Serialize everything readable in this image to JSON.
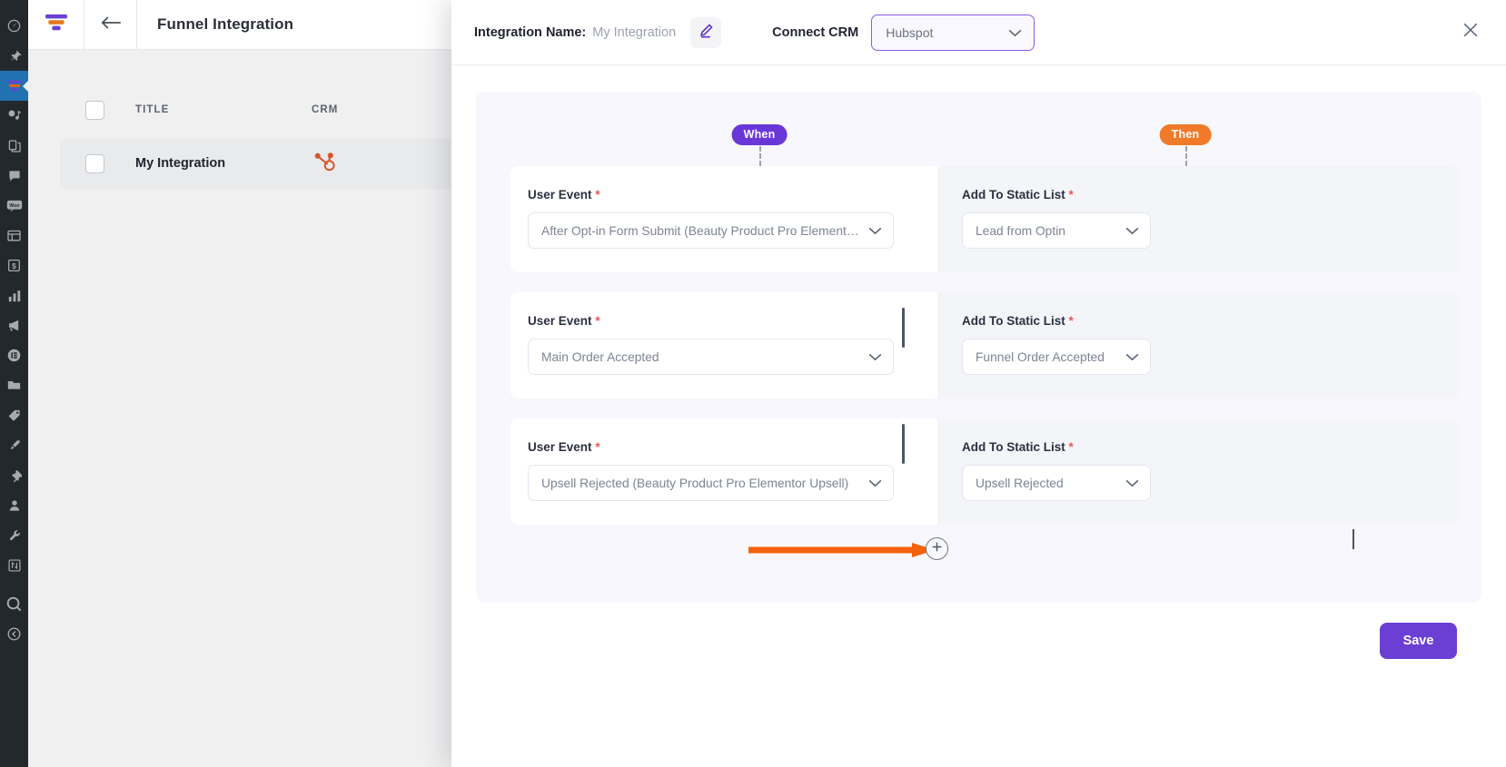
{
  "colors": {
    "accent_purple": "#6b3fd4",
    "badge_when": "#6937d8",
    "badge_then": "#f07a2a",
    "arrow_orange": "#f4620a",
    "required_red": "#f0534f",
    "hubspot_orange": "#d9532a"
  },
  "wp_sidebar": {
    "items": [
      {
        "name": "dashboard-icon"
      },
      {
        "name": "pin-icon"
      },
      {
        "name": "funnel-icon",
        "active": true
      },
      {
        "name": "media-icon"
      },
      {
        "name": "pages-icon"
      },
      {
        "name": "comments-icon"
      },
      {
        "name": "woo-icon"
      },
      {
        "name": "products-icon"
      },
      {
        "name": "payments-icon"
      },
      {
        "name": "analytics-icon"
      },
      {
        "name": "marketing-icon"
      },
      {
        "name": "elementor-icon"
      },
      {
        "name": "folder-icon"
      },
      {
        "name": "tag-icon"
      },
      {
        "name": "appearance-icon"
      },
      {
        "name": "plugins-icon"
      },
      {
        "name": "users-icon"
      },
      {
        "name": "tools-icon"
      },
      {
        "name": "settings-icon"
      },
      {
        "name": "search-icon"
      },
      {
        "name": "collapse-icon"
      }
    ]
  },
  "background_page": {
    "title": "Funnel Integration",
    "back_icon": "arrow-left-icon",
    "logo_icon": "funnel-logo-icon",
    "table": {
      "columns": [
        "TITLE",
        "CRM"
      ],
      "rows": [
        {
          "title": "My Integration",
          "crm_icon": "hubspot-icon"
        }
      ]
    }
  },
  "modal": {
    "header": {
      "integration_name_label": "Integration Name:",
      "integration_name_value": "My Integration",
      "edit_icon": "pencil-icon",
      "connect_crm_label": "Connect CRM",
      "crm_selected": "Hubspot",
      "crm_chevron_icon": "chevron-down-icon",
      "close_icon": "close-icon"
    },
    "flow": {
      "when_badge": "When",
      "then_badge": "Then",
      "when_label": "User Event",
      "then_label": "Add To Static List",
      "required_marker": "*",
      "add_icon": "plus-icon",
      "arrow_icon": "arrow-right-icon",
      "rules": [
        {
          "event": "After Opt-in Form Submit (Beauty Product Pro Elementor Landing)",
          "list": "Lead from Optin"
        },
        {
          "event": "Main Order Accepted",
          "list": "Funnel Order Accepted"
        },
        {
          "event": "Upsell Rejected (Beauty Product Pro Elementor Upsell)",
          "list": "Upsell Rejected"
        }
      ]
    },
    "footer": {
      "save_label": "Save"
    }
  }
}
